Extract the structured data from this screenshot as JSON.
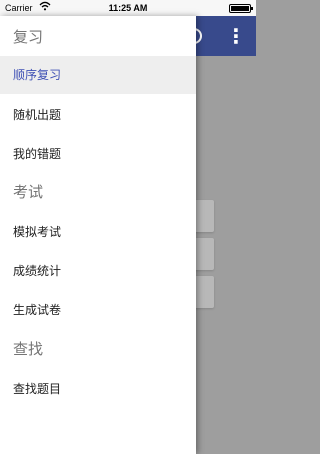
{
  "status_bar": {
    "carrier": "Carrier",
    "time": "11:25 AM"
  },
  "app_bar": {
    "more_icon": "⋮"
  },
  "drawer": {
    "sections": [
      {
        "header": "复习",
        "items": [
          "顺序复习",
          "随机出题",
          "我的错题"
        ]
      },
      {
        "header": "考试",
        "items": [
          "模拟考试",
          "成绩统计",
          "生成试卷"
        ]
      },
      {
        "header": "查找",
        "items": [
          "查找题目"
        ]
      }
    ],
    "selected_item": "顺序复习"
  },
  "colors": {
    "primary": "#384a8c",
    "selected_text": "#3f51b5",
    "selected_bg": "#eeeeee",
    "scrim": "#9e9e9e"
  }
}
